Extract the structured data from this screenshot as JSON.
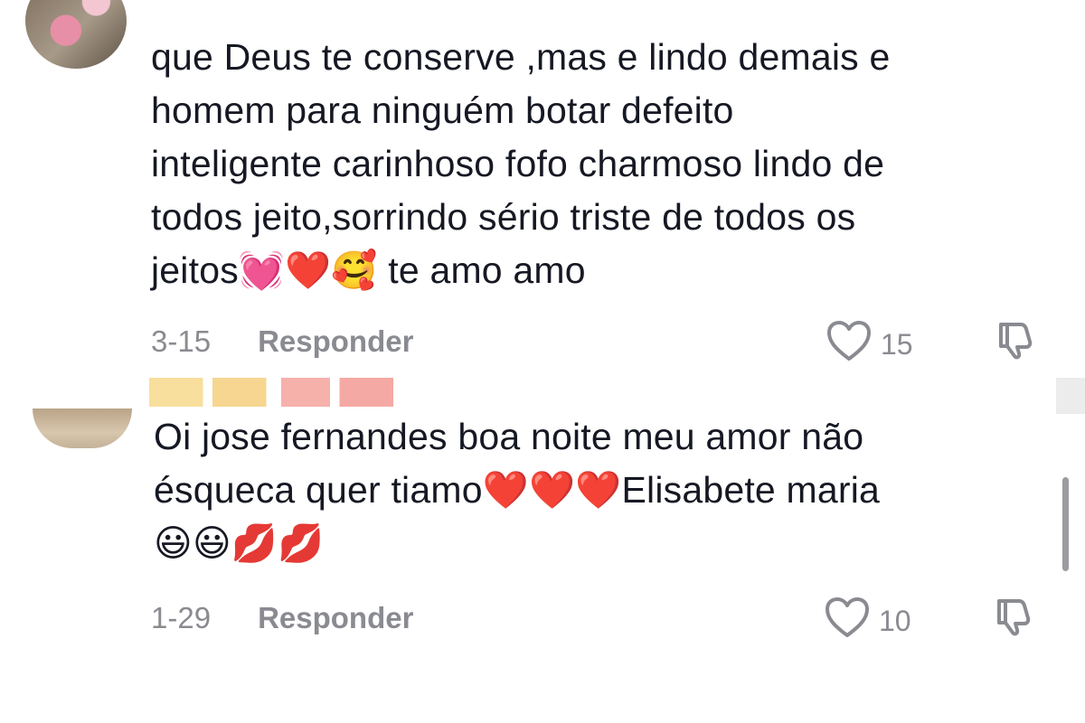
{
  "comments": [
    {
      "text": "que Deus te conserve ,mas e lindo demais e\nhomem para ninguém botar defeito\ninteligente carinhoso fofo charmoso lindo de\ntodos jeito,sorrindo sério triste de todos os\njeitos💓❤️🥰 te amo amo",
      "date": "3-15",
      "reply_label": "Responder",
      "like_count": "15"
    },
    {
      "text": "Oi jose fernandes boa noite meu amor não\nésqueca quer tiamo❤️❤️❤️Elisabete maria\n😃😃💋💋",
      "date": "1-29",
      "reply_label": "Responder",
      "like_count": "10"
    }
  ],
  "icons": {
    "like": "heart-outline-icon",
    "dislike": "thumbs-down-icon"
  },
  "colors": {
    "text": "#161823",
    "meta": "#8a8b91"
  }
}
